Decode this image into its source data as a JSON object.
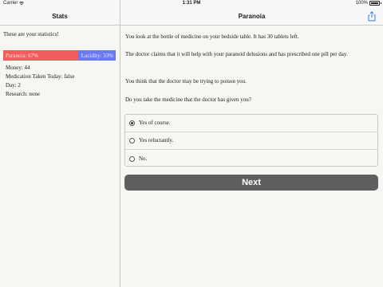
{
  "status_bar": {
    "carrier": "Carrier",
    "time": "1:31 PM",
    "battery": "100%"
  },
  "sidebar": {
    "title": "Stats",
    "intro": "These are your statistics!",
    "meter": {
      "paranoia_label": "Paranoia: 67%",
      "lucidity_label": "Lucidity: 33%",
      "paranoia_fraction": 0.67,
      "paranoia_color": "#f25c5c",
      "lucidity_color": "#6b79f0"
    },
    "stats": [
      "Money: 44",
      "Medication Taken Today: false",
      "Day: 2",
      "Research: none"
    ]
  },
  "main": {
    "title": "Paranoia",
    "paragraphs": [
      "You look at the bottle of medicine on your bedside table. It has 30 tablets left.",
      "The doctor claims that it will help with your paranoid delusions and has prescribed one pill per day.",
      "You think that the doctor may be trying to poison you.",
      "Do you take the medicine that the doctor has given you?"
    ],
    "choices": [
      {
        "label": "Yes of course.",
        "selected": true
      },
      {
        "label": "Yes reluctantly.",
        "selected": false
      },
      {
        "label": "No.",
        "selected": false
      }
    ],
    "next_label": "Next",
    "next_color": "#5f5f5f"
  }
}
